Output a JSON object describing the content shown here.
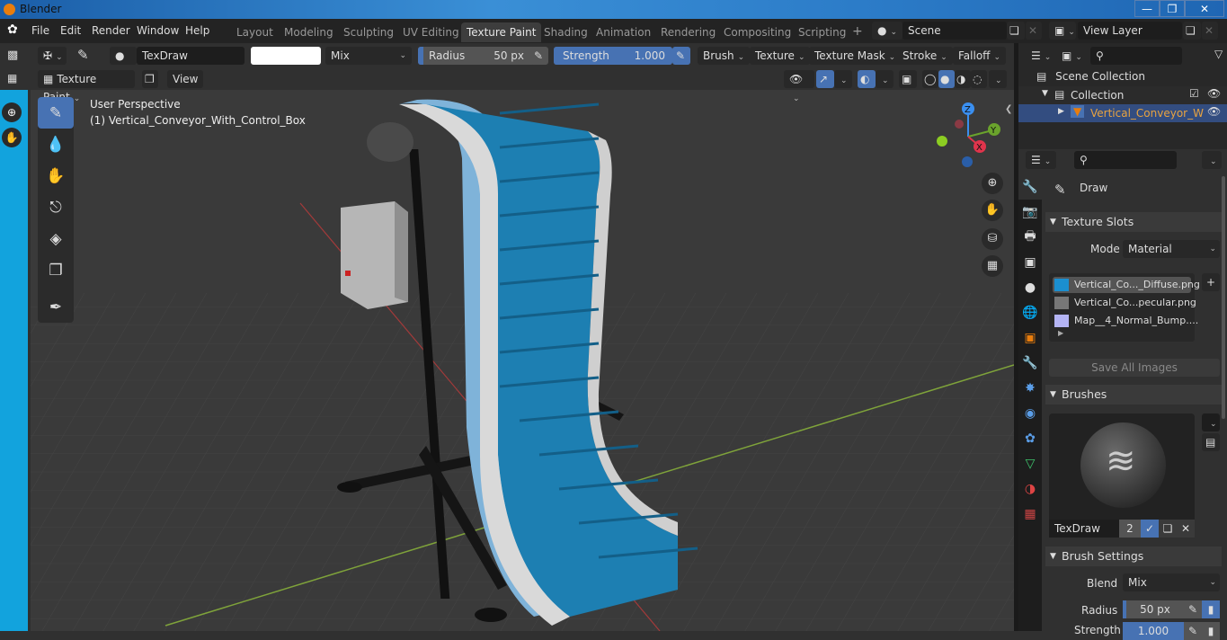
{
  "window": {
    "title": "Blender",
    "controls": [
      "minimize",
      "maximize",
      "close"
    ]
  },
  "menu": [
    "File",
    "Edit",
    "Render",
    "Window",
    "Help"
  ],
  "workspaces": [
    {
      "label": "Layout",
      "active": false
    },
    {
      "label": "Modeling",
      "active": false
    },
    {
      "label": "Sculpting",
      "active": false
    },
    {
      "label": "UV Editing",
      "active": false
    },
    {
      "label": "Texture Paint",
      "active": true
    },
    {
      "label": "Shading",
      "active": false
    },
    {
      "label": "Animation",
      "active": false
    },
    {
      "label": "Rendering",
      "active": false
    },
    {
      "label": "Compositing",
      "active": false
    },
    {
      "label": "Scripting",
      "active": false
    }
  ],
  "add_workspace": "+",
  "scene": {
    "name": "Scene",
    "view_layer": "View Layer"
  },
  "tool_header": {
    "brush_name": "TexDraw",
    "color": "#ffffff",
    "blend": "Mix",
    "radius_label": "Radius",
    "radius_value": "50 px",
    "strength_label": "Strength",
    "strength_value": "1.000",
    "strength_fraction": 1.0,
    "menus": [
      "Brush",
      "Texture",
      "Texture Mask",
      "Stroke",
      "Falloff"
    ]
  },
  "viewport_header": {
    "mode": "Texture Paint",
    "view": "View"
  },
  "viewport": {
    "perspective": "User Perspective",
    "object_label": "(1) Vertical_Conveyor_With_Control_Box",
    "gizmo_axes": [
      "Z",
      "Y",
      "X"
    ],
    "accent": "#4772b3"
  },
  "outliner": {
    "items": [
      {
        "label": "Scene Collection"
      },
      {
        "label": "Collection"
      },
      {
        "label": "Vertical_Conveyor_W"
      }
    ]
  },
  "properties": {
    "tool_name": "Draw",
    "texture_slots": {
      "title": "Texture Slots",
      "mode_label": "Mode",
      "mode_value": "Material",
      "slots": [
        "Vertical_Co..._Diffuse.png",
        "Vertical_Co...pecular.png",
        "Map__4_Normal_Bump...."
      ],
      "save_all": "Save All Images"
    },
    "brushes": {
      "title": "Brushes",
      "name": "TexDraw",
      "users": "2"
    },
    "brush_settings": {
      "title": "Brush Settings",
      "blend_label": "Blend",
      "blend_value": "Mix",
      "radius_label": "Radius",
      "radius_value": "50 px",
      "strength_label": "Strength",
      "strength_value": "1.000"
    }
  }
}
